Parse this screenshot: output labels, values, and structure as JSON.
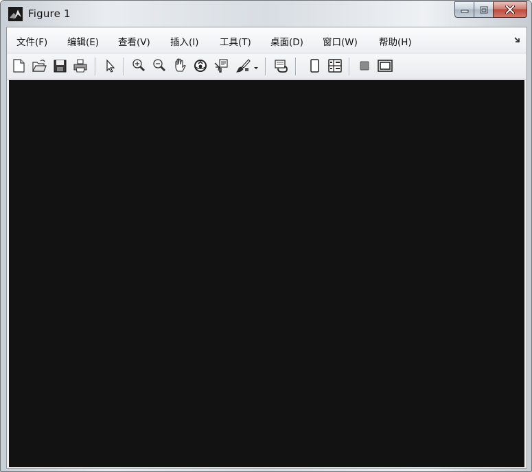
{
  "window": {
    "title": "Figure 1"
  },
  "menu": {
    "items": [
      {
        "label": "文件(F)"
      },
      {
        "label": "编辑(E)"
      },
      {
        "label": "查看(V)"
      },
      {
        "label": "插入(I)"
      },
      {
        "label": "工具(T)"
      },
      {
        "label": "桌面(D)"
      },
      {
        "label": "窗口(W)"
      },
      {
        "label": "帮助(H)"
      }
    ]
  },
  "toolbar": {
    "buttons": [
      {
        "icon": "new-figure-icon"
      },
      {
        "icon": "open-file-icon"
      },
      {
        "icon": "save-icon"
      },
      {
        "icon": "print-icon"
      },
      {
        "icon": "edit-plot-arrow-icon"
      },
      {
        "icon": "zoom-in-icon"
      },
      {
        "icon": "zoom-out-icon"
      },
      {
        "icon": "pan-hand-icon"
      },
      {
        "icon": "rotate-3d-icon"
      },
      {
        "icon": "data-cursor-icon"
      },
      {
        "icon": "brush-icon"
      },
      {
        "icon": "link-plot-icon"
      },
      {
        "icon": "hide-plot-tools-icon"
      },
      {
        "icon": "show-plot-tools-icon"
      },
      {
        "icon": "insert-colorbar-icon"
      },
      {
        "icon": "insert-legend-icon"
      }
    ]
  },
  "colors": {
    "canvas": "#121212",
    "close_button": "#c75545"
  }
}
